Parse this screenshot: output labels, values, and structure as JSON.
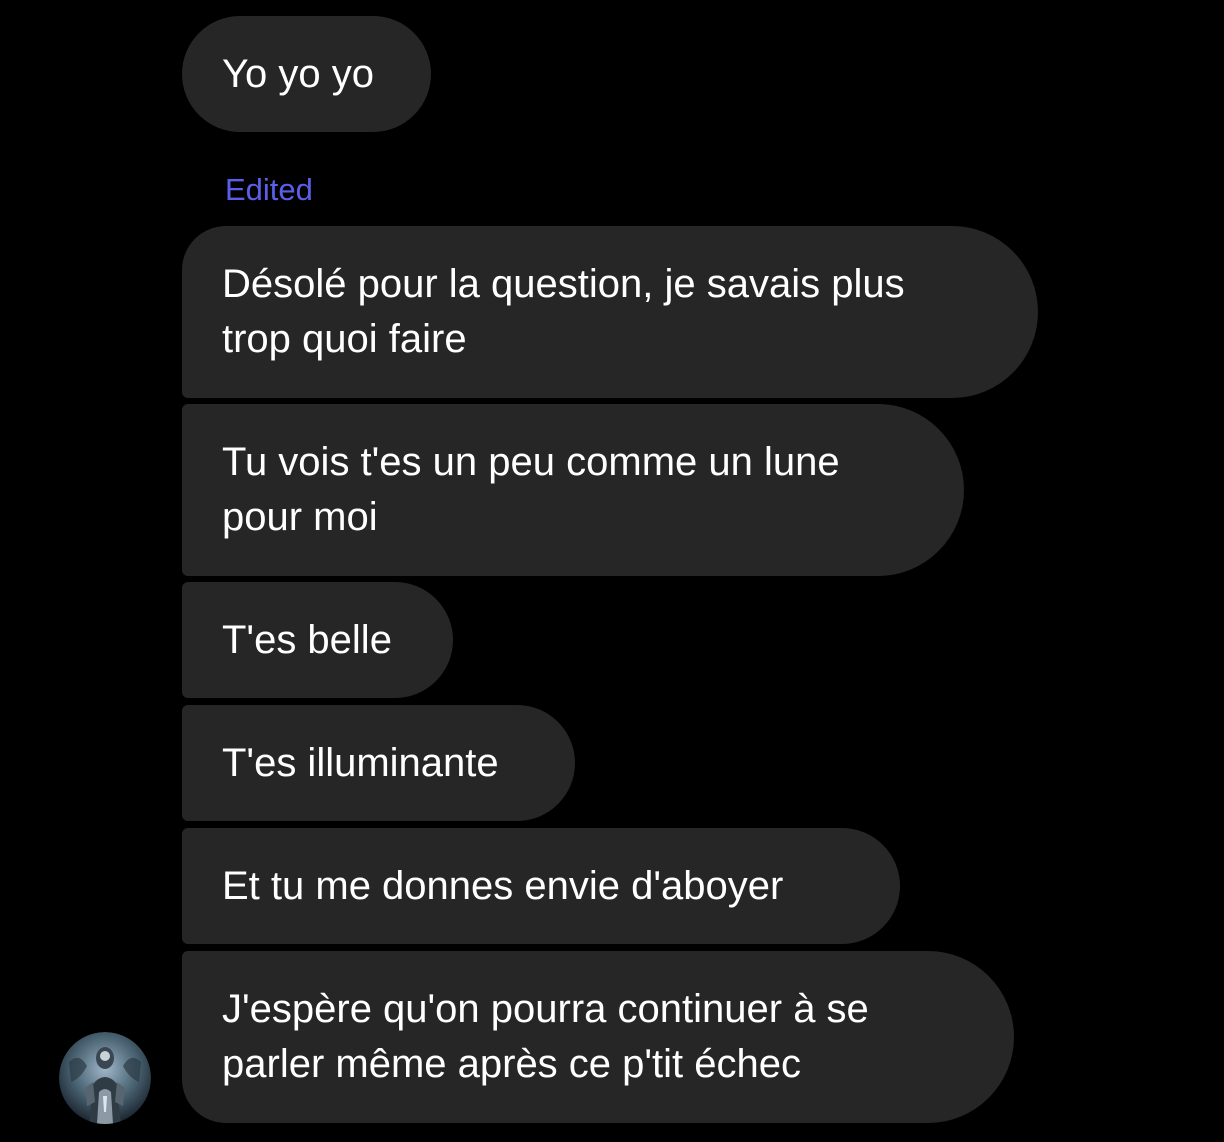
{
  "conversation": {
    "edited_label": "Edited",
    "messages": [
      {
        "text": "Yo yo yo"
      },
      {
        "text": "Désolé pour la question, je savais plus\ntrop quoi faire"
      },
      {
        "text": "Tu vois t'es un peu comme un lune\npour moi"
      },
      {
        "text": "T'es belle"
      },
      {
        "text": "T'es illuminante"
      },
      {
        "text": "Et tu me donnes envie d'aboyer"
      },
      {
        "text": "J'espère qu'on pourra continuer à se\nparler même après ce p'tit échec"
      }
    ]
  },
  "colors": {
    "background": "#000000",
    "bubble": "#262626",
    "text": "#ffffff",
    "edited": "#5b5fe8"
  },
  "avatar": {
    "icon": "user-avatar"
  }
}
